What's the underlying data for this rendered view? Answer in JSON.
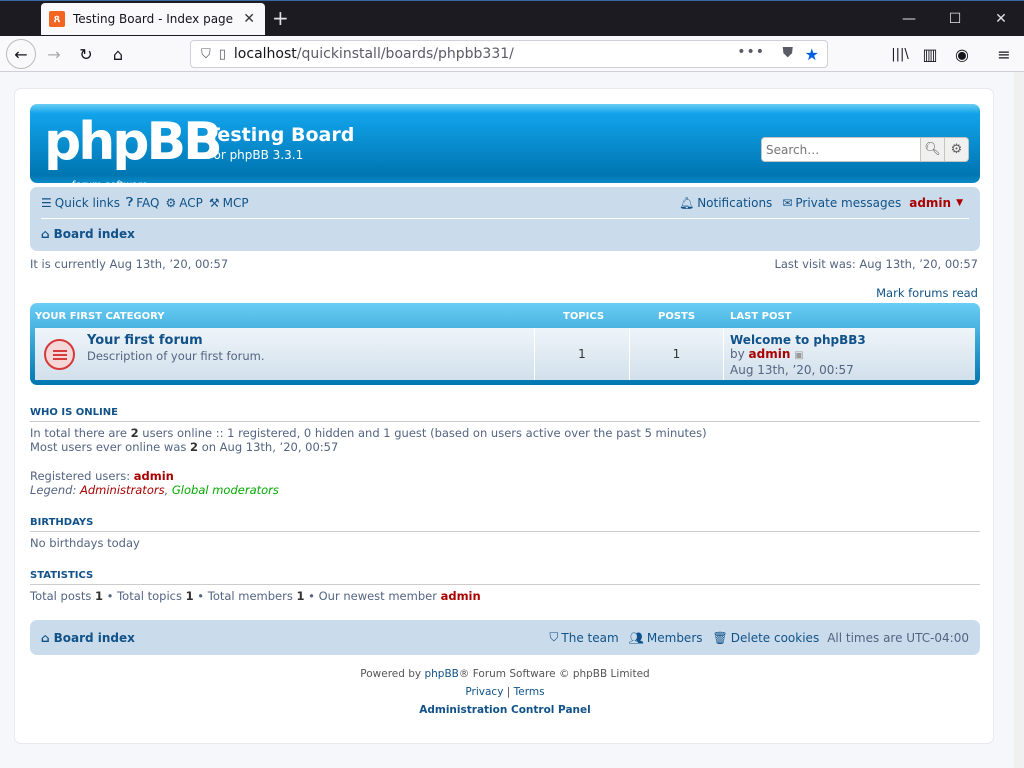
{
  "browser": {
    "tab_title": "Testing Board - Index page",
    "url_host": "localhost",
    "url_path": "/quickinstall/boards/phpbb331/"
  },
  "header": {
    "logo_text": "phpBB",
    "logo_sub": "forum software",
    "site_name": "Testing Board",
    "site_desc": "For phpBB 3.3.1",
    "search_placeholder": "Search…"
  },
  "nav": {
    "quick_links": "Quick links",
    "faq": "FAQ",
    "acp": "ACP",
    "mcp": "MCP",
    "notifications": "Notifications",
    "private_messages": "Private messages",
    "username": "admin",
    "breadcrumb": "Board index"
  },
  "info": {
    "current_time": "It is currently Aug 13th, ’20, 00:57",
    "last_visit": "Last visit was: Aug 13th, ’20, 00:57",
    "mark_read": "Mark forums read"
  },
  "category": {
    "name": "Your first category",
    "col_topics": "Topics",
    "col_posts": "Posts",
    "col_last": "Last post",
    "forum": {
      "title": "Your first forum",
      "desc": "Description of your first forum.",
      "topics": "1",
      "posts": "1",
      "last_title": "Welcome to phpBB3",
      "last_by": "by",
      "last_user": "admin",
      "last_time": "Aug 13th, ’20, 00:57"
    }
  },
  "online": {
    "heading": "Who is online",
    "line1_a": "In total there are ",
    "line1_n": "2",
    "line1_b": " users online :: 1 registered, 0 hidden and 1 guest (based on users active over the past 5 minutes)",
    "line2_a": "Most users ever online was ",
    "line2_n": "2",
    "line2_b": " on Aug 13th, ’20, 00:57",
    "registered_label": "Registered users: ",
    "registered_user": "admin",
    "legend_label": "Legend: ",
    "legend_admins": "Administrators",
    "legend_sep": ", ",
    "legend_mods": "Global moderators"
  },
  "birthdays": {
    "heading": "Birthdays",
    "text": "No birthdays today"
  },
  "stats": {
    "heading": "Statistics",
    "posts_label": "Total posts ",
    "posts": "1",
    "topics_label": " • Total topics ",
    "topics": "1",
    "members_label": " • Total members ",
    "members": "1",
    "newest_label": " • Our newest member ",
    "newest": "admin"
  },
  "footer": {
    "board_index": "Board index",
    "team": "The team",
    "members": "Members",
    "delete_cookies": "Delete cookies",
    "timezone": "All times are UTC-04:00",
    "powered_a": "Powered by ",
    "powered_link": "phpBB",
    "powered_b": "® Forum Software © phpBB Limited",
    "privacy": "Privacy",
    "terms": "Terms",
    "acp": "Administration Control Panel"
  }
}
